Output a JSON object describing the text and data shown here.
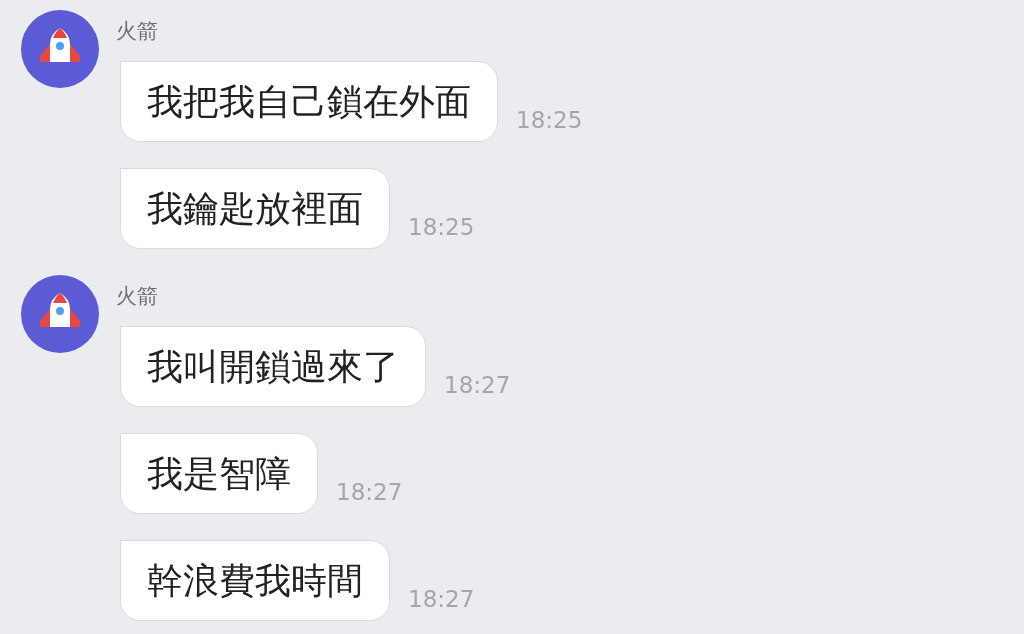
{
  "groups": [
    {
      "sender": "火箭",
      "messages": [
        {
          "text": "我把我自己鎖在外面",
          "time": "18:25"
        },
        {
          "text": "我鑰匙放裡面",
          "time": "18:25"
        }
      ]
    },
    {
      "sender": "火箭",
      "messages": [
        {
          "text": "我叫開鎖過來了",
          "time": "18:27"
        },
        {
          "text": "我是智障",
          "time": "18:27"
        },
        {
          "text": "幹浪費我時間",
          "time": "18:27"
        }
      ]
    }
  ]
}
